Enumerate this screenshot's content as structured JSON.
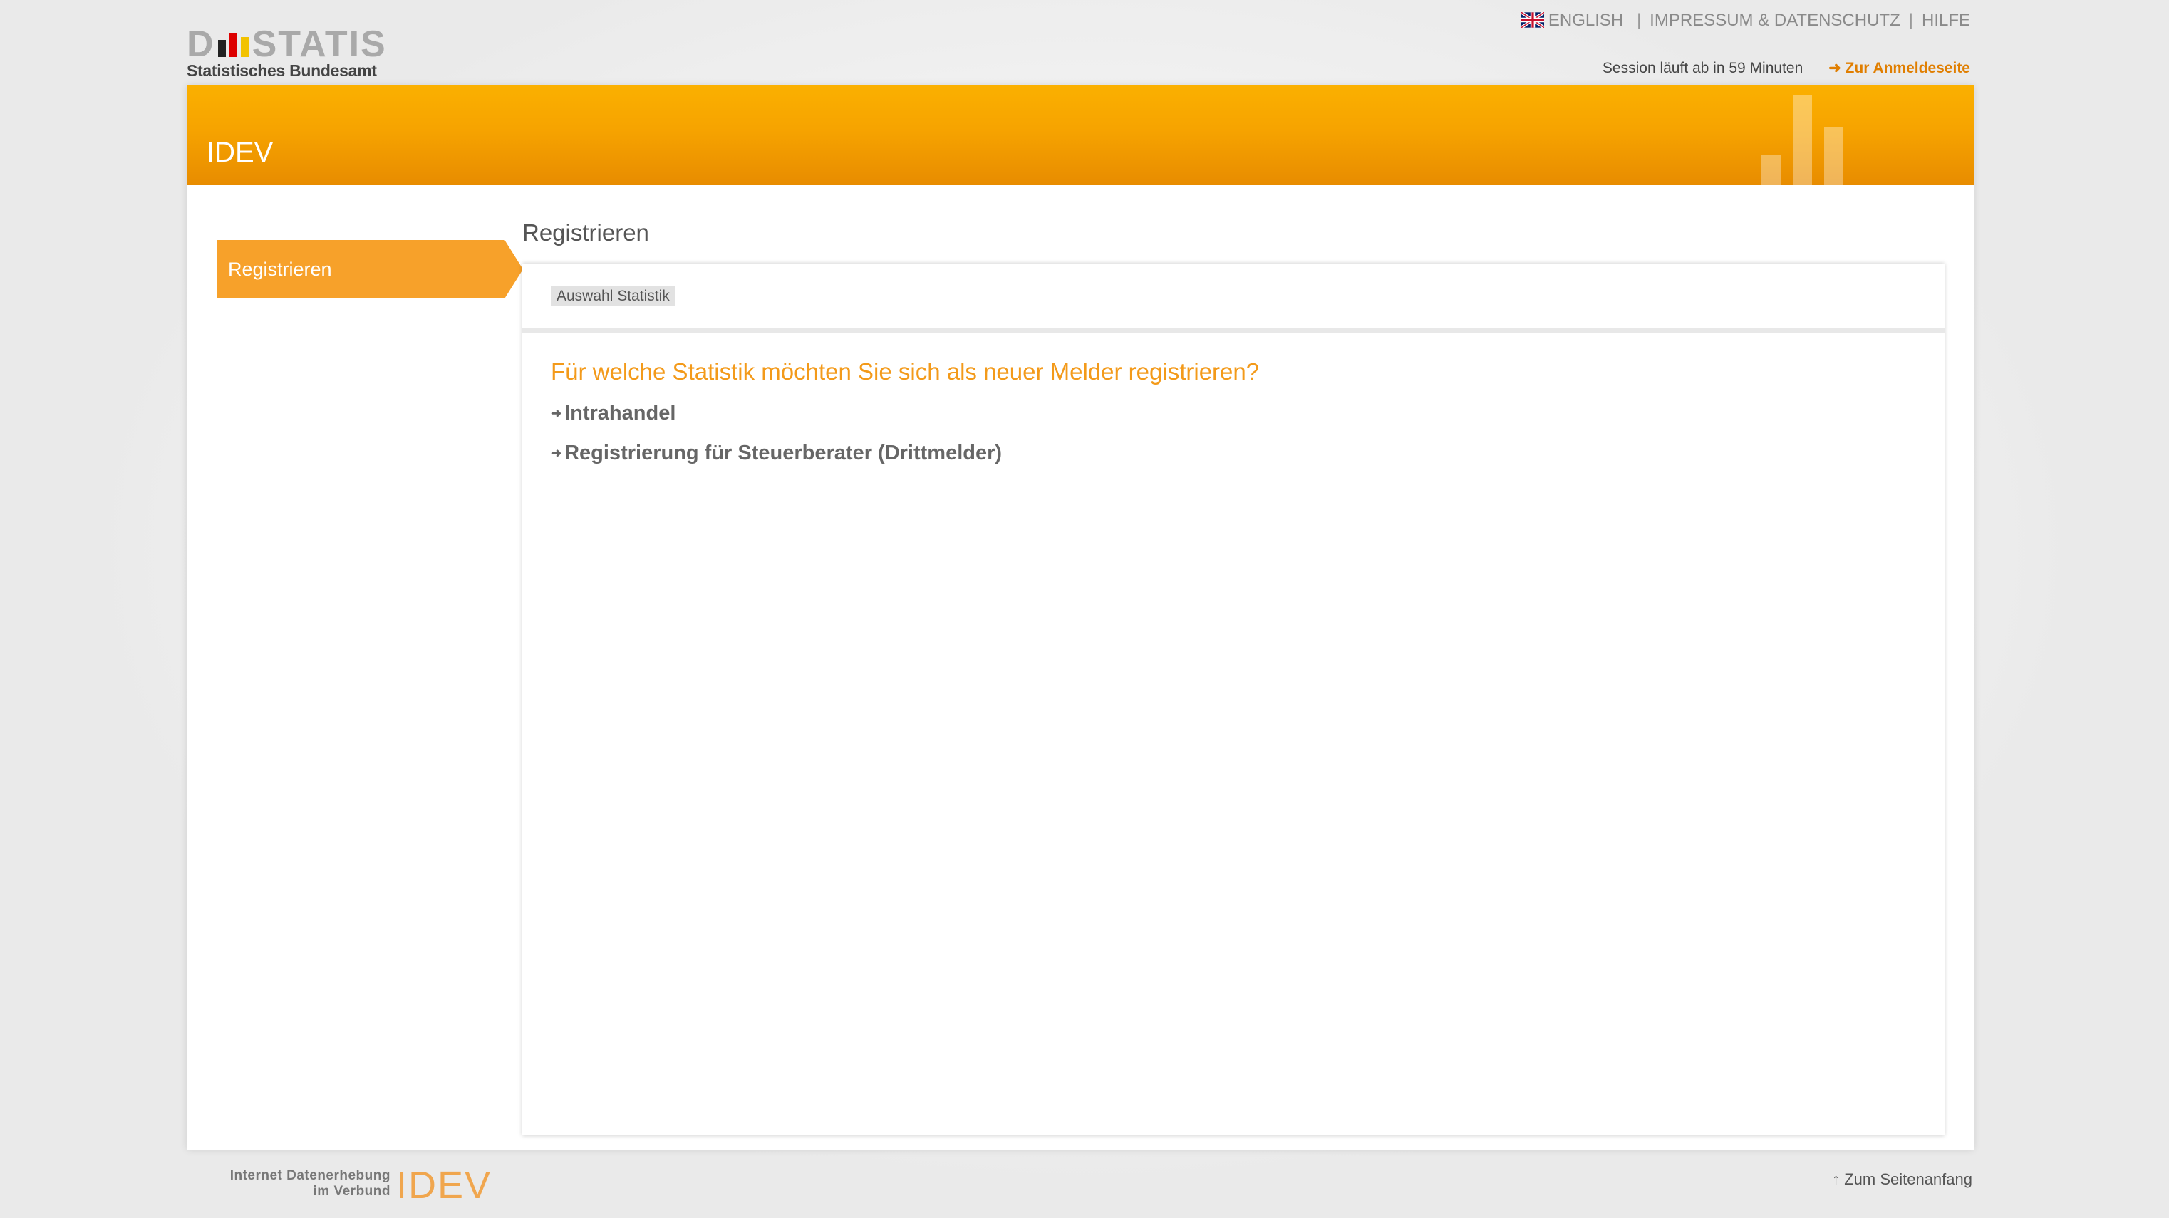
{
  "header": {
    "logo_word": "DSTATIS",
    "logo_subtitle": "Statistisches Bundesamt",
    "links": {
      "english": "ENGLISH",
      "separator": "|",
      "impressum": "IMPRESSUM & DATENSCHUTZ",
      "help": "HILFE"
    },
    "session_text": "Session läuft ab in 59 Minuten",
    "login_link": "➜ Zur Anmeldeseite"
  },
  "banner": {
    "title": "IDEV"
  },
  "sidebar": {
    "items": [
      {
        "label": "Registrieren",
        "active": true
      }
    ]
  },
  "main": {
    "title": "Registrieren",
    "breadcrumb": "Auswahl Statistik",
    "question": "Für welche Statistik möchten Sie sich als neuer Melder registrieren?",
    "options": [
      {
        "label": "Intrahandel"
      },
      {
        "label": "Registrierung für Steuerberater (Drittmelder)"
      }
    ]
  },
  "footer": {
    "tagline_line1": "Internet Datenerhebung",
    "tagline_line2": "im Verbund",
    "logo": "IDEV",
    "to_top": "↑ Zum Seitenanfang"
  },
  "colors": {
    "accent": "#f7a12a",
    "banner_top": "#fbb000",
    "banner_bottom": "#e88c00",
    "link_orange": "#e07e00",
    "question_orange": "#f39a1a"
  },
  "icons": {
    "flag": "uk-flag-icon",
    "arrow": "arrow-right-icon",
    "up": "arrow-up-icon"
  }
}
